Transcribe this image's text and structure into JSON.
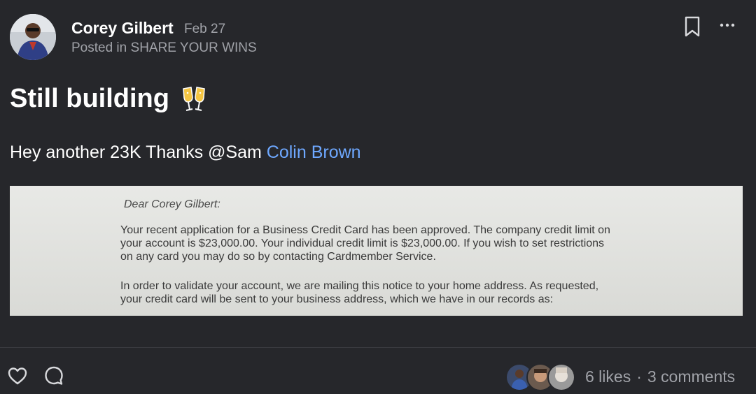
{
  "post": {
    "author": "Corey Gilbert",
    "date": "Feb 27",
    "posted_in_prefix": "Posted in",
    "category": "SHARE YOUR WINS",
    "title": "Still building",
    "title_emoji": "clinking-glasses-icon",
    "body_prefix": "Hey another 23K Thanks @Sam",
    "body_mention": "Colin Brown"
  },
  "letter": {
    "greeting": "Dear Corey Gilbert:",
    "paragraph1": [
      "Your recent application for a Business Credit Card has been approved.  The company credit limit on",
      "your account is $23,000.00.  Your individual credit limit is $23,000.00.  If you wish to set restrictions",
      "on any card you may do so by contacting Cardmember Service."
    ],
    "paragraph2": [
      "In order to validate your account, we are mailing this notice to your home address.  As requested,",
      "your credit card will be sent to your business address, which we have in our records as:"
    ]
  },
  "footer": {
    "likes": "6 likes",
    "separator": "·",
    "comments": "3 comments"
  },
  "icons": {
    "bookmark": "bookmark-icon",
    "more": "more-options-icon",
    "like": "heart-icon",
    "comment": "comment-icon"
  },
  "colors": {
    "background": "#26272b",
    "mention": "#6ea8ff",
    "muted": "#a0a2a8"
  }
}
